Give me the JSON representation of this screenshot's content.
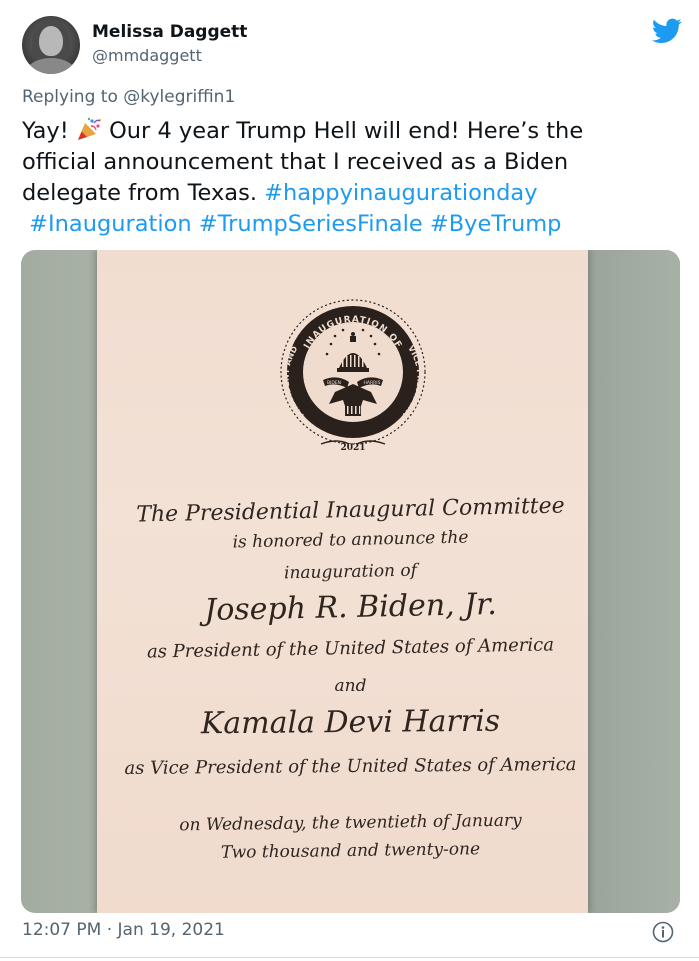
{
  "tweet": {
    "author_name": "Melissa Daggett",
    "author_handle": "@mmdaggett",
    "replying_to": "Replying to @kylegriffin1",
    "text_part1": "Yay! ",
    "text_part2": " Our 4 year Trump Hell will end! Here’s the official announcement that I received as a Biden delegate from Texas. ",
    "hashtags": [
      "#happyinaugurationday",
      "#Inauguration",
      "#TrumpSeriesFinale",
      "#ByeTrump"
    ],
    "timestamp": "12:07 PM · Jan 19, 2021",
    "icons": {
      "logo": "twitter-bird-icon",
      "emoji": "party-popper-icon",
      "info": "info-icon"
    },
    "colors": {
      "link": "#1d9bf0",
      "brand": "#1d9bf0",
      "muted": "#536471"
    }
  },
  "invitation": {
    "seal_top": "INAUGURATION OF",
    "seal_left": "PRESIDENT AND",
    "seal_right": "VICE PRESIDENT",
    "seal_ribbon_left": "BIDEN",
    "seal_ribbon_right": "HARRIS",
    "seal_year": "2021",
    "line1": "The Presidential Inaugural Committee",
    "line2": "is honored to announce the",
    "line3": "inauguration of",
    "line4": "Joseph R. Biden, Jr.",
    "line5": "as President of the United States of America",
    "line6": "and",
    "line7": "Kamala Devi Harris",
    "line8": "as Vice President of the United States of America",
    "line9": "on Wednesday, the twentieth of January",
    "line10": "Two thousand and twenty-one"
  }
}
